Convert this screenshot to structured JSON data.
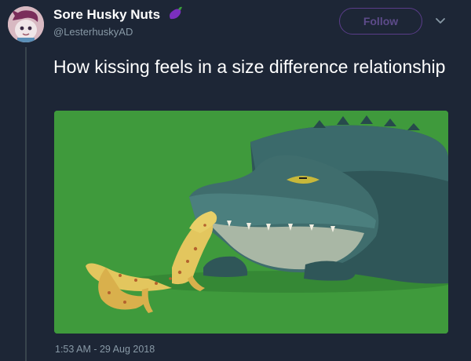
{
  "tweet": {
    "display_name": "Sore Husky Nuts",
    "name_emoji_icon": "eggplant-icon",
    "handle": "@LesterhuskyAD",
    "follow_label": "Follow",
    "menu_icon": "chevron-down-icon",
    "text": "How kissing feels in a size difference relationship",
    "timestamp": "1:53 AM - 29 Aug 2018"
  },
  "media": {
    "description_icon": "crocodile-and-gecko-kissing-illustration"
  },
  "colors": {
    "background": "#1d2636",
    "muted_text": "#8899a6",
    "follow_accent": "#5a3d8a",
    "image_green": "#3f9a3c",
    "eggplant": "#7b2fbf"
  }
}
